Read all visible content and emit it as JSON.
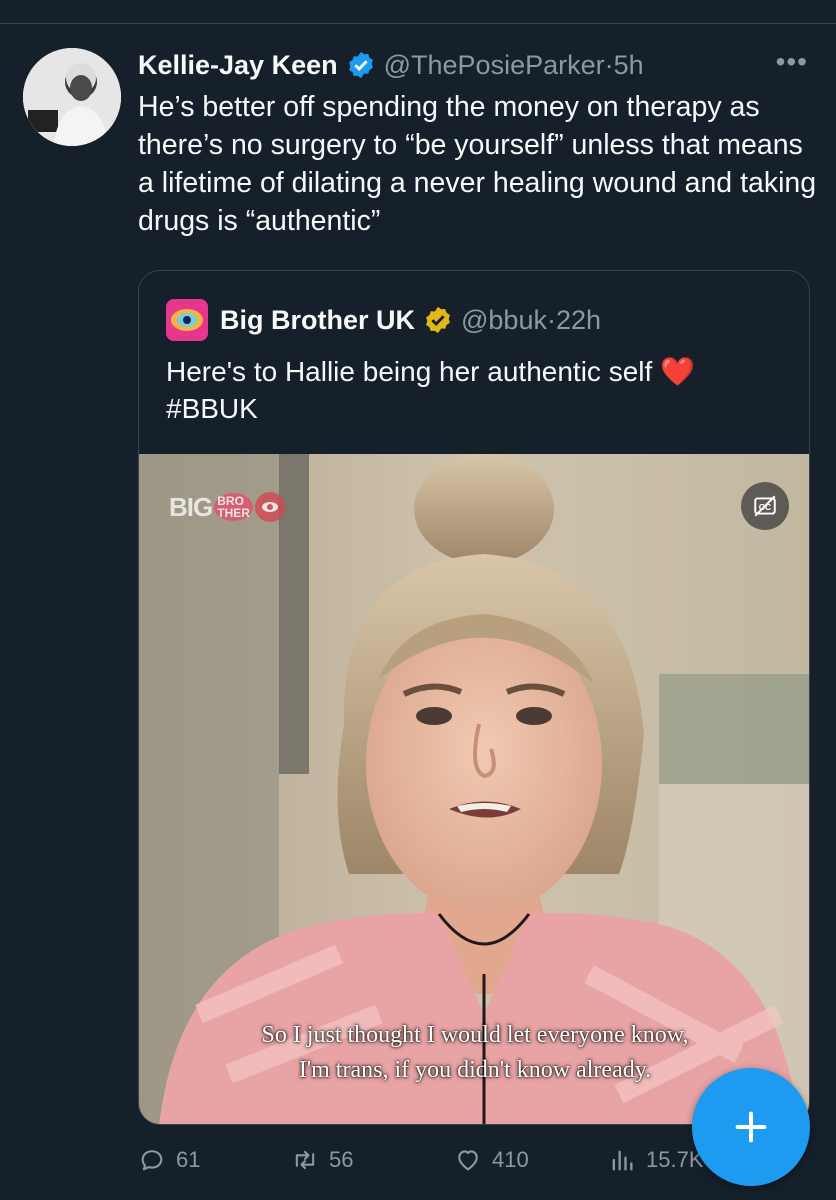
{
  "tweet": {
    "author_name": "Kellie-Jay Keen",
    "author_handle": "@ThePosieParker",
    "separator": "·",
    "time": "5h",
    "more": "•••",
    "text": "He’s better off spending the money on therapy as there’s no surgery to “be yourself” unless that means a lifetime of dilating a never healing wound and taking drugs is “authentic”"
  },
  "quoted": {
    "author_name": "Big Brother UK",
    "author_handle": "@bbuk",
    "separator": "·",
    "time": "22h",
    "text": "Here's to Hallie being her authentic self ❤️ #BBUK",
    "media": {
      "logo_big": "BIG",
      "logo_small_1": "BRO",
      "logo_small_2": "THER",
      "cc_icon": "closed-captions-icon",
      "subtitle_line1": "So I just thought I would let everyone know,",
      "subtitle_line2": "I'm trans, if you didn't know already."
    }
  },
  "actions": {
    "replies": "61",
    "retweets": "56",
    "likes": "410",
    "views": "15.7K"
  },
  "fab": {
    "icon": "plus-icon"
  },
  "colors": {
    "background": "#15202b",
    "text": "#f7f9f9",
    "secondary": "#8b98a5",
    "accent": "#1d9bf0",
    "gold": "#e2b719",
    "heart": "#f91880"
  }
}
